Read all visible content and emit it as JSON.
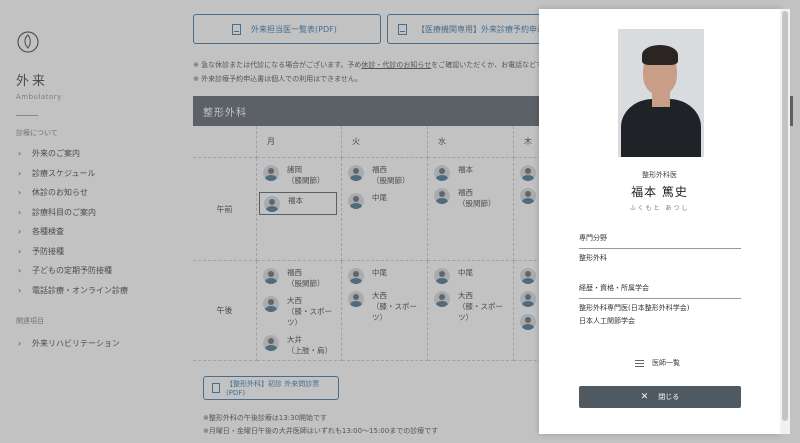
{
  "sidebar": {
    "title": "外来",
    "subtitle": "Ambulatory",
    "group1_label": "診療について",
    "items": [
      {
        "label": "外来のご案内"
      },
      {
        "label": "診療スケジュール"
      },
      {
        "label": "休診のお知らせ"
      },
      {
        "label": "診療科目のご案内"
      },
      {
        "label": "各種検査"
      },
      {
        "label": "予防接種"
      },
      {
        "label": "子どもの定期予防接種"
      },
      {
        "label": "電話診療・オンライン診療"
      }
    ],
    "group2_label": "関連項目",
    "related_items": [
      {
        "label": "外来リハビリテーション"
      }
    ]
  },
  "main": {
    "pdf_button_1": "外来担当医一覧表(PDF)",
    "pdf_button_2": "【医療機関専用】外来診療予約申込書",
    "note1": "※ 急な休診または代診になる場合がございます。予め",
    "note1_link": "休診・代診のお知らせ",
    "note1_rest": "をご確認いただくか、お電話などでお問い",
    "note2": "※ 外来診療予約申込書は個人での利用はできません。",
    "dept_title": "整形外科",
    "days": [
      "月",
      "火",
      "水",
      "木"
    ],
    "row_am": "午前",
    "row_pm": "午後",
    "schedule": {
      "am": [
        [
          {
            "name": "諸岡",
            "note": "（膝関節）"
          },
          {
            "name": "福本",
            "note": ""
          }
        ],
        [
          {
            "name": "福西",
            "note": "（股関節）"
          },
          {
            "name": "中尾",
            "note": ""
          }
        ],
        [
          {
            "name": "福本",
            "note": ""
          },
          {
            "name": "福西",
            "note": "（股関節）"
          }
        ],
        [
          {
            "name": "",
            "note": ""
          },
          {
            "name": "",
            "note": ""
          }
        ]
      ],
      "pm": [
        [
          {
            "name": "福西",
            "note": "（股関節）"
          },
          {
            "name": "大西",
            "note": "（膝・スポーツ）"
          },
          {
            "name": "大井",
            "note": "（上肢・肩）"
          }
        ],
        [
          {
            "name": "中尾",
            "note": ""
          },
          {
            "name": "大西",
            "note": "（膝・スポーツ）"
          }
        ],
        [
          {
            "name": "中尾",
            "note": ""
          },
          {
            "name": "大西",
            "note": "（膝・スポーツ）"
          }
        ],
        [
          {
            "name": "",
            "note": ""
          },
          {
            "name": "",
            "note": ""
          },
          {
            "name": "",
            "note": ""
          }
        ]
      ]
    },
    "pdf_button_3": "【整形外科】初診 外来問診票(PDF)",
    "foot_note1": "※整形外科の午後診療は13:30開始です",
    "foot_note2": "※月曜日・金曜日午後の大井医師はいずれも13:00～15:00までの診療です"
  },
  "modal": {
    "department": "整形外科医",
    "name": "福本 篤史",
    "kana": "ふくもと あつし",
    "specialty_label": "専門分野",
    "specialty_value": "整形外科",
    "career_label": "経歴・資格・所属学会",
    "career_line1": "整形外科専門医(日本整形外科学会)",
    "career_line2": "日本人工関節学会",
    "doctor_list_label": "医師一覧",
    "close_label": "閉じる"
  }
}
